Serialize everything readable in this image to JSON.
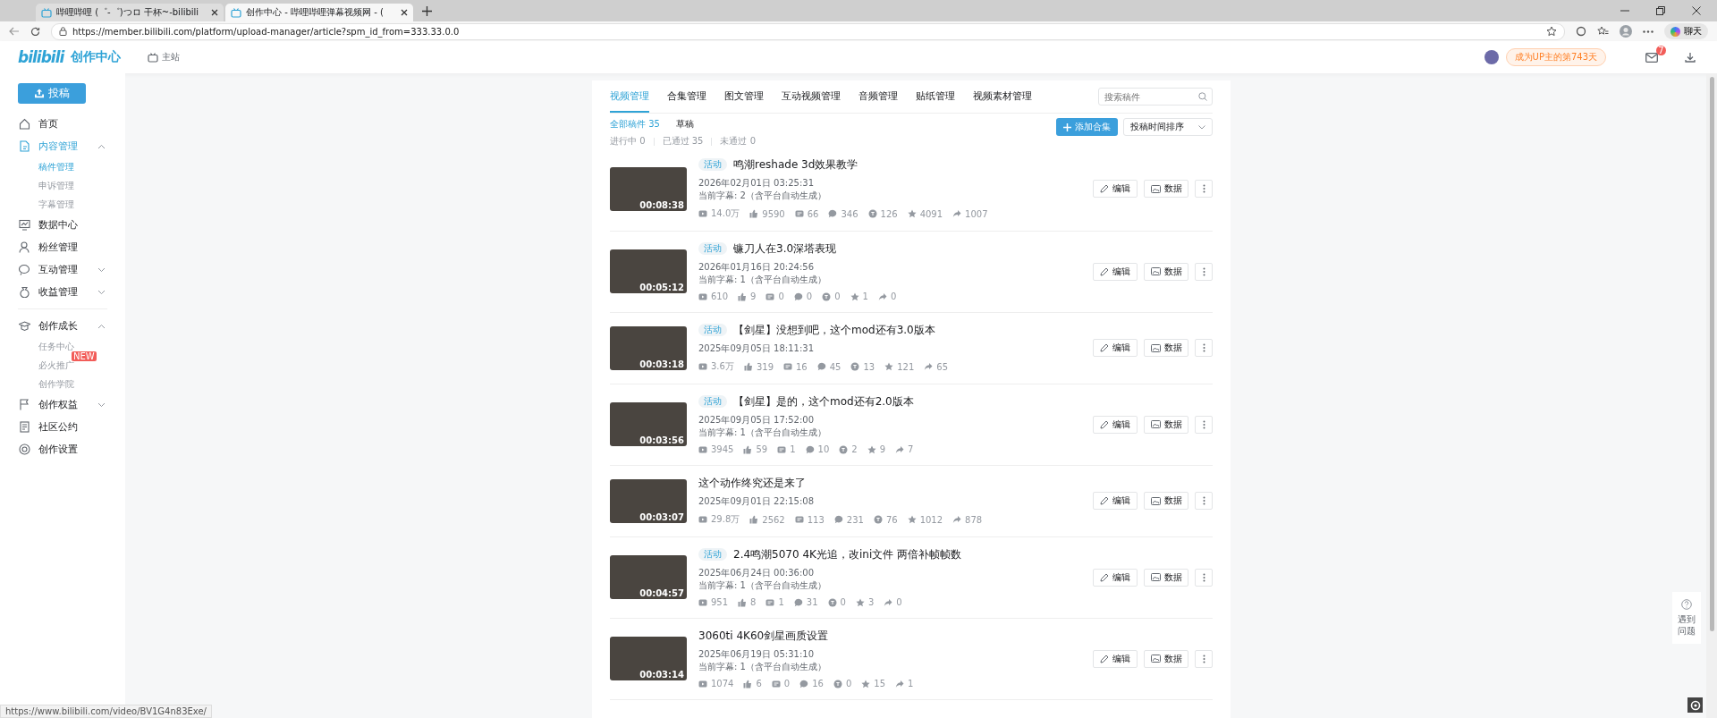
{
  "browser": {
    "tabs": [
      {
        "title": "哔哩哔哩 (゜-゜)つロ 干杯~-bilibili",
        "selected": false
      },
      {
        "title": "创作中心 - 哔哩哔哩弹幕视频网 - (",
        "selected": true
      }
    ],
    "url": "https://member.bilibili.com/platform/upload-manager/article?spm_id_from=333.33.0.0",
    "chat_button": "聊天"
  },
  "header": {
    "logo": "bilibili",
    "logo_title": "创作中心",
    "home_link": "主站",
    "up_days": "成为UP主的第743天",
    "mail_badge": "7"
  },
  "sidebar": {
    "upload_button": "投稿",
    "sections": [
      {
        "items": [
          {
            "label": "首页",
            "selected": false
          },
          {
            "label": "内容管理",
            "selected": true,
            "expanded": true,
            "children": [
              {
                "label": "稿件管理",
                "selected": true
              },
              {
                "label": "申诉管理",
                "selected": false
              },
              {
                "label": "字幕管理",
                "selected": false
              }
            ]
          },
          {
            "label": "数据中心",
            "selected": false
          },
          {
            "label": "粉丝管理",
            "selected": false
          },
          {
            "label": "互动管理",
            "selected": false,
            "expanded": false
          },
          {
            "label": "收益管理",
            "selected": false,
            "expanded": false
          }
        ]
      },
      {
        "items": [
          {
            "label": "创作成长",
            "selected": false,
            "expanded": true,
            "children": [
              {
                "label": "任务中心",
                "selected": false
              },
              {
                "label": "必火推广",
                "selected": false,
                "badge": "NEW"
              },
              {
                "label": "创作学院",
                "selected": false
              }
            ]
          },
          {
            "label": "创作权益",
            "selected": false,
            "expanded": false
          },
          {
            "label": "社区公约",
            "selected": false
          },
          {
            "label": "创作设置",
            "selected": false
          }
        ]
      }
    ]
  },
  "tabs": [
    {
      "label": "视频管理",
      "selected": true
    },
    {
      "label": "合集管理",
      "selected": false
    },
    {
      "label": "图文管理",
      "selected": false
    },
    {
      "label": "互动视频管理",
      "selected": false
    },
    {
      "label": "音频管理",
      "selected": false
    },
    {
      "label": "贴纸管理",
      "selected": false
    },
    {
      "label": "视频素材管理",
      "selected": false
    }
  ],
  "search": {
    "placeholder": "搜索稿件"
  },
  "subtabs": [
    {
      "label": "全部稿件 35",
      "selected": true
    },
    {
      "label": "草稿",
      "selected": false
    }
  ],
  "filters": [
    "进行中 0",
    "已通过 35",
    "未通过 0"
  ],
  "add_collection_button": "添加合集",
  "sort_dropdown": "投稿时间排序",
  "videos": [
    {
      "tag": "活动",
      "title": "鸣潮reshade 3d效果教学",
      "duration": "00:08:38",
      "date": "2026年02月01日 03:25:31",
      "subtitle_info": "当前字幕: 2（含平台自动生成）",
      "stats": [
        "14.0万",
        "9590",
        "66",
        "346",
        "126",
        "4091",
        "1007"
      ],
      "buttons": [
        "编辑",
        "数据"
      ]
    },
    {
      "tag": "活动",
      "title": "镰刀人在3.0深塔表现",
      "duration": "00:05:12",
      "date": "2026年01月16日 20:24:56",
      "subtitle_info": "当前字幕: 1（含平台自动生成）",
      "stats": [
        "610",
        "9",
        "0",
        "0",
        "0",
        "1",
        "0"
      ],
      "buttons": [
        "编辑",
        "数据"
      ]
    },
    {
      "tag": "活动",
      "title": "【剑星】没想到吧，这个mod还有3.0版本",
      "duration": "00:03:18",
      "date": "2025年09月05日 18:11:31",
      "stats": [
        "3.6万",
        "319",
        "16",
        "45",
        "13",
        "121",
        "65"
      ],
      "buttons": [
        "编辑",
        "数据"
      ]
    },
    {
      "tag": "活动",
      "title": "【剑星】是的，这个mod还有2.0版本",
      "duration": "00:03:56",
      "date": "2025年09月05日 17:52:00",
      "subtitle_info": "当前字幕: 1（含平台自动生成）",
      "stats": [
        "3945",
        "59",
        "1",
        "10",
        "2",
        "9",
        "7"
      ],
      "buttons": [
        "编辑",
        "数据"
      ]
    },
    {
      "title": "这个动作终究还是来了",
      "duration": "00:03:07",
      "date": "2025年09月01日 22:15:08",
      "stats": [
        "29.8万",
        "2562",
        "113",
        "231",
        "76",
        "1012",
        "878"
      ],
      "buttons": [
        "编辑",
        "数据"
      ]
    },
    {
      "tag": "活动",
      "title": "2.4鸣潮5070 4K光追，改ini文件 两倍补帧帧数",
      "duration": "00:04:57",
      "date": "2025年06月24日 00:36:00",
      "subtitle_info": "当前字幕: 1（含平台自动生成）",
      "stats": [
        "951",
        "8",
        "1",
        "31",
        "0",
        "3",
        "0"
      ],
      "buttons": [
        "编辑",
        "数据"
      ]
    },
    {
      "title": "3060ti 4K60剑星画质设置",
      "duration": "00:03:14",
      "date": "2025年06月19日 05:31:10",
      "subtitle_info": "当前字幕: 1（含平台自动生成）",
      "stats": [
        "1074",
        "6",
        "0",
        "16",
        "0",
        "15",
        "1"
      ],
      "buttons": [
        "编辑",
        "数据"
      ]
    }
  ],
  "help": "遇到问题",
  "status_bar": "https://www.bilibili.com/video/BV1G4n83Exe/"
}
